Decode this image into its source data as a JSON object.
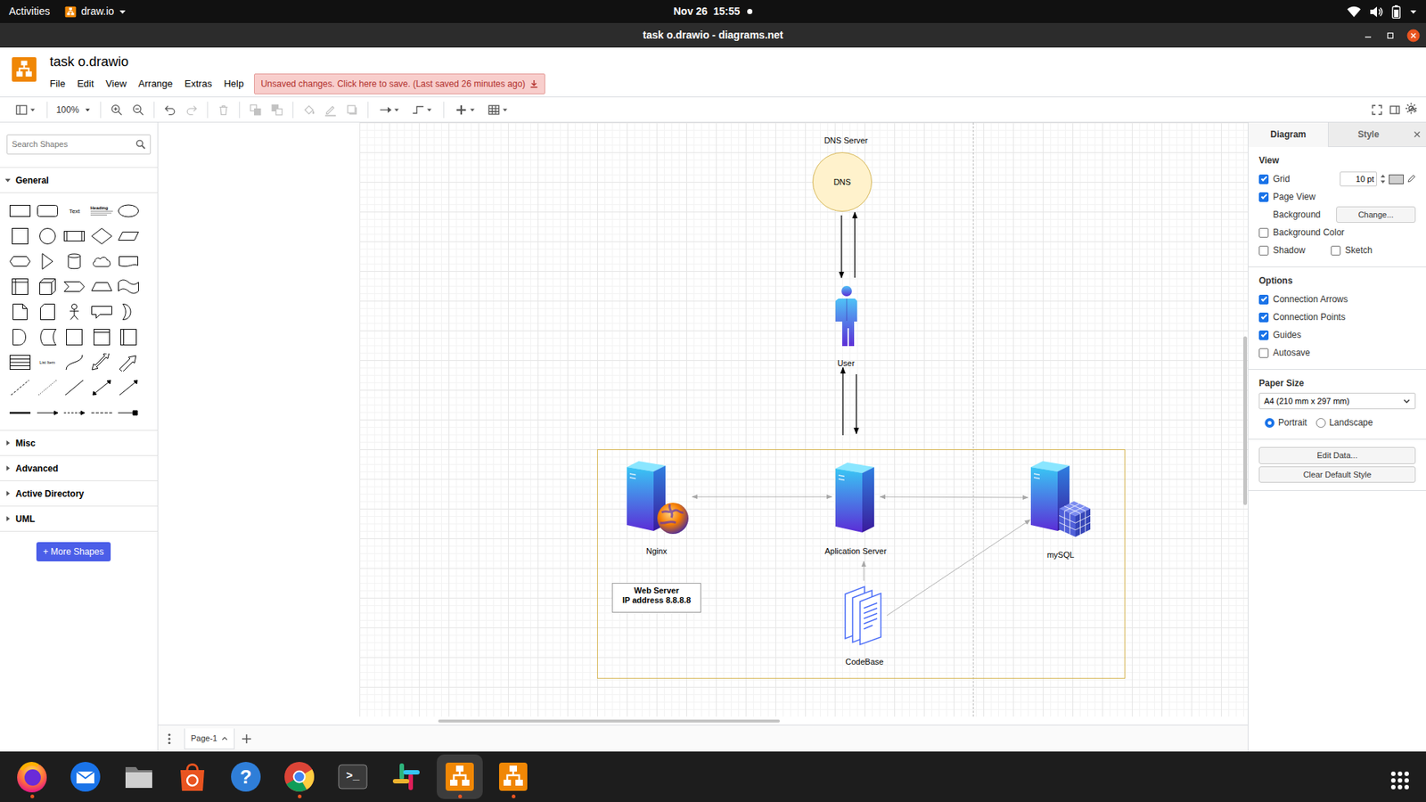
{
  "topbar": {
    "activities": "Activities",
    "app": "draw.io",
    "clock": "Nov 26  15:55",
    "notification": true
  },
  "window": {
    "title": "task o.drawio - diagrams.net"
  },
  "app": {
    "filename": "task o.drawio",
    "menus": [
      "File",
      "Edit",
      "View",
      "Arrange",
      "Extras",
      "Help"
    ],
    "save_banner": "Unsaved changes. Click here to save. (Last saved 26 minutes ago)"
  },
  "toolbar": {
    "tools": [
      {
        "kind": "format",
        "disabled": false
      },
      {
        "kind": "zoom",
        "label": "100%",
        "disabled": false
      },
      {
        "kind": "zoom-in",
        "disabled": false
      },
      {
        "kind": "zoom-out",
        "disabled": false
      },
      {
        "kind": "undo",
        "disabled": false
      },
      {
        "kind": "redo",
        "disabled": true
      },
      {
        "kind": "delete",
        "disabled": true
      },
      {
        "kind": "to-front",
        "disabled": true
      },
      {
        "kind": "to-back",
        "disabled": true
      },
      {
        "kind": "fill",
        "disabled": true
      },
      {
        "kind": "line",
        "disabled": true
      },
      {
        "kind": "shadow",
        "disabled": true
      },
      {
        "kind": "connection",
        "disabled": false
      },
      {
        "kind": "waypoints",
        "disabled": false
      },
      {
        "kind": "insert",
        "disabled": false
      },
      {
        "kind": "table",
        "disabled": false
      }
    ]
  },
  "sidebar": {
    "search_placeholder": "Search Shapes",
    "sections": [
      {
        "label": "General",
        "expanded": true
      },
      {
        "label": "Misc",
        "expanded": false
      },
      {
        "label": "Advanced",
        "expanded": false
      },
      {
        "label": "Active Directory",
        "expanded": false
      },
      {
        "label": "UML",
        "expanded": false
      }
    ],
    "shapes": [
      {
        "kind": "rect"
      },
      {
        "kind": "rounded"
      },
      {
        "kind": "text",
        "label": "Text"
      },
      {
        "kind": "textbox",
        "label": "Heading"
      },
      {
        "kind": "ellipse"
      },
      {
        "kind": "square"
      },
      {
        "kind": "circle"
      },
      {
        "kind": "process"
      },
      {
        "kind": "diamond"
      },
      {
        "kind": "parallelogram"
      },
      {
        "kind": "hexagon"
      },
      {
        "kind": "triangle"
      },
      {
        "kind": "cylinder"
      },
      {
        "kind": "cloud"
      },
      {
        "kind": "document"
      },
      {
        "kind": "internal-storage"
      },
      {
        "kind": "cube"
      },
      {
        "kind": "step"
      },
      {
        "kind": "trapezoid"
      },
      {
        "kind": "tape"
      },
      {
        "kind": "note"
      },
      {
        "kind": "card"
      },
      {
        "kind": "actor"
      },
      {
        "kind": "callout"
      },
      {
        "kind": "or"
      },
      {
        "kind": "and"
      },
      {
        "kind": "data-storage"
      },
      {
        "kind": "container"
      },
      {
        "kind": "container-v"
      },
      {
        "kind": "container-h"
      },
      {
        "kind": "list"
      },
      {
        "kind": "list-item",
        "label": "List Item"
      },
      {
        "kind": "curve"
      },
      {
        "kind": "bidirectional-arrow"
      },
      {
        "kind": "arrow"
      },
      {
        "kind": "dashed-line"
      },
      {
        "kind": "dotted-line"
      },
      {
        "kind": "line"
      },
      {
        "kind": "bidirectional-connector"
      },
      {
        "kind": "directional-connector"
      },
      {
        "kind": "link"
      },
      {
        "kind": "connector-arrow"
      },
      {
        "kind": "connector-dashed"
      },
      {
        "kind": "connector-dotted"
      },
      {
        "kind": "connector-block"
      }
    ],
    "more_button": "+ More Shapes"
  },
  "canvas": {
    "nodes": [
      {
        "kind": "dns",
        "title": "DNS Server",
        "label": "DNS"
      },
      {
        "kind": "user",
        "label": "User"
      },
      {
        "kind": "web-server",
        "label": "Nginx"
      },
      {
        "kind": "app-server",
        "label": "Aplication Server"
      },
      {
        "kind": "database",
        "label": "mySQL"
      },
      {
        "kind": "codebase",
        "label": "CodeBase"
      },
      {
        "kind": "note",
        "label": "Web Server",
        "detail": "IP address 8.8.8.8"
      }
    ]
  },
  "format_panel": {
    "tabs": [
      {
        "label": "Diagram",
        "selected": true
      },
      {
        "label": "Style",
        "selected": false
      }
    ],
    "view": {
      "heading": "View",
      "grid": {
        "label": "Grid",
        "checked": true,
        "size": "10 pt"
      },
      "page_view": {
        "label": "Page View",
        "checked": true
      },
      "background": {
        "label": "Background",
        "button": "Change..."
      },
      "background_color": {
        "label": "Background Color",
        "checked": false
      },
      "shadow": {
        "label": "Shadow",
        "checked": false
      },
      "sketch": {
        "label": "Sketch",
        "checked": false
      }
    },
    "options": {
      "heading": "Options",
      "items": [
        {
          "label": "Connection Arrows",
          "checked": true
        },
        {
          "label": "Connection Points",
          "checked": true
        },
        {
          "label": "Guides",
          "checked": true
        },
        {
          "label": "Autosave",
          "checked": false
        }
      ]
    },
    "paper": {
      "heading": "Paper Size",
      "size": "A4 (210 mm x 297 mm)",
      "orientations": [
        {
          "label": "Portrait",
          "selected": true
        },
        {
          "label": "Landscape",
          "selected": false
        }
      ]
    },
    "buttons": [
      "Edit Data...",
      "Clear Default Style"
    ]
  },
  "pages": [
    {
      "label": "Page-1",
      "selected": true
    }
  ],
  "dock": [
    {
      "kind": "firefox",
      "running": true,
      "selected": false
    },
    {
      "kind": "thunderbird",
      "running": false,
      "selected": false
    },
    {
      "kind": "files",
      "running": false,
      "selected": false
    },
    {
      "kind": "software",
      "running": false,
      "selected": false
    },
    {
      "kind": "help",
      "glyph": "?",
      "running": false,
      "selected": false
    },
    {
      "kind": "chrome",
      "running": true,
      "selected": false
    },
    {
      "kind": "terminal",
      "glyph": ">_",
      "running": false,
      "selected": false
    },
    {
      "kind": "slack",
      "running": false,
      "selected": false
    },
    {
      "kind": "drawio",
      "running": true,
      "selected": true
    },
    {
      "kind": "drawio",
      "running": true,
      "selected": false
    }
  ]
}
